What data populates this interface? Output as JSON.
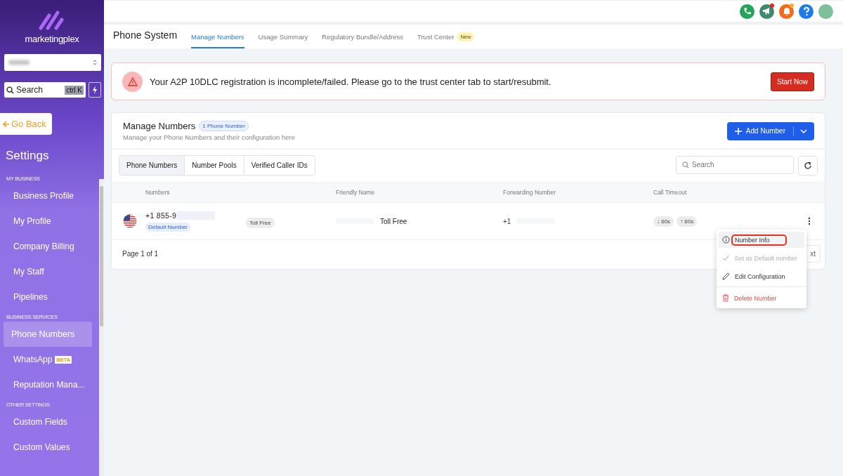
{
  "sidebar": {
    "logo": "marketingplex",
    "search": {
      "placeholder": "Search",
      "shortcut": "ctrl K"
    },
    "back": "Go Back",
    "title": "Settings",
    "sections": [
      {
        "heading": "MY BUSINESS",
        "items": [
          {
            "label": "Business Profile",
            "selected": false
          },
          {
            "label": "My Profile",
            "selected": false
          },
          {
            "label": "Company Billing",
            "selected": false
          },
          {
            "label": "My Staff",
            "selected": false
          },
          {
            "label": "Pipelines",
            "selected": false
          }
        ]
      },
      {
        "heading": "BUSINESS SERVICES",
        "items": [
          {
            "label": "Phone Numbers",
            "selected": true
          },
          {
            "label": "WhatsApp",
            "badge": "BETA",
            "selected": false
          },
          {
            "label": "Reputation Mana...",
            "selected": false
          }
        ]
      },
      {
        "heading": "OTHER SETTINGS",
        "items": [
          {
            "label": "Custom Fields",
            "selected": false
          },
          {
            "label": "Custom Values",
            "selected": false
          }
        ]
      }
    ]
  },
  "topbar": {
    "icons": [
      {
        "kind": "phone",
        "color": "#22a55b",
        "dot": false
      },
      {
        "kind": "megaphone",
        "color": "#3e8a6e",
        "dot": true
      },
      {
        "kind": "bell",
        "color": "#f26b1d",
        "dot": true
      },
      {
        "kind": "help",
        "color": "#1f7ae8",
        "dot": false
      },
      {
        "kind": "avatar",
        "color": "#7dc09c",
        "dot": false
      }
    ]
  },
  "header": {
    "title": "Phone System",
    "tabs": [
      {
        "label": "Manage Numbers",
        "selected": true
      },
      {
        "label": "Usage Summary",
        "selected": false
      },
      {
        "label": "Regulatory Bundle/Address",
        "selected": false
      },
      {
        "label": "Trust Center",
        "badge": "New",
        "selected": false
      }
    ]
  },
  "alert": {
    "message": "Your A2P 10DLC registration is incomplete/failed. Please go to the trust center tab to start/resubmit.",
    "button": "Start Now"
  },
  "card": {
    "title": "Manage Numbers",
    "count_badge": "1 Phone Number",
    "subtitle": "Manage your Phone Numbers and their configuration here",
    "add_button": "Add Number",
    "segments": [
      {
        "label": "Phone Numbers",
        "selected": true
      },
      {
        "label": "Number Pools",
        "selected": false
      },
      {
        "label": "Verified Caller IDs",
        "selected": false
      }
    ],
    "search": {
      "placeholder": "Search"
    },
    "table": {
      "columns": [
        "Numbers",
        "Friendly Name",
        "Forwarding Number",
        "Call Timeout"
      ],
      "rows": [
        {
          "number": "+1 855-9",
          "default_badge": "Default Number",
          "type": "Toll Free",
          "friendly_name": "Toll Free",
          "forwarding": "+1",
          "timeouts": [
            "↓ 60s",
            "↑ 60s"
          ]
        }
      ]
    },
    "pagination": {
      "label": "Page 1 of 1",
      "next": "xt"
    }
  },
  "menu": {
    "items": [
      {
        "label": "Number Info",
        "kind": "info",
        "disabled": false,
        "selected": true,
        "highlighted": true
      },
      {
        "label": "Set as Default number",
        "kind": "check",
        "disabled": true,
        "selected": false,
        "highlighted": false
      },
      {
        "label": "Edit Configuration",
        "kind": "edit",
        "disabled": false,
        "selected": false,
        "highlighted": false
      },
      {
        "label": "Delete Number",
        "kind": "delete",
        "disabled": false,
        "selected": false,
        "highlighted": false
      }
    ]
  }
}
